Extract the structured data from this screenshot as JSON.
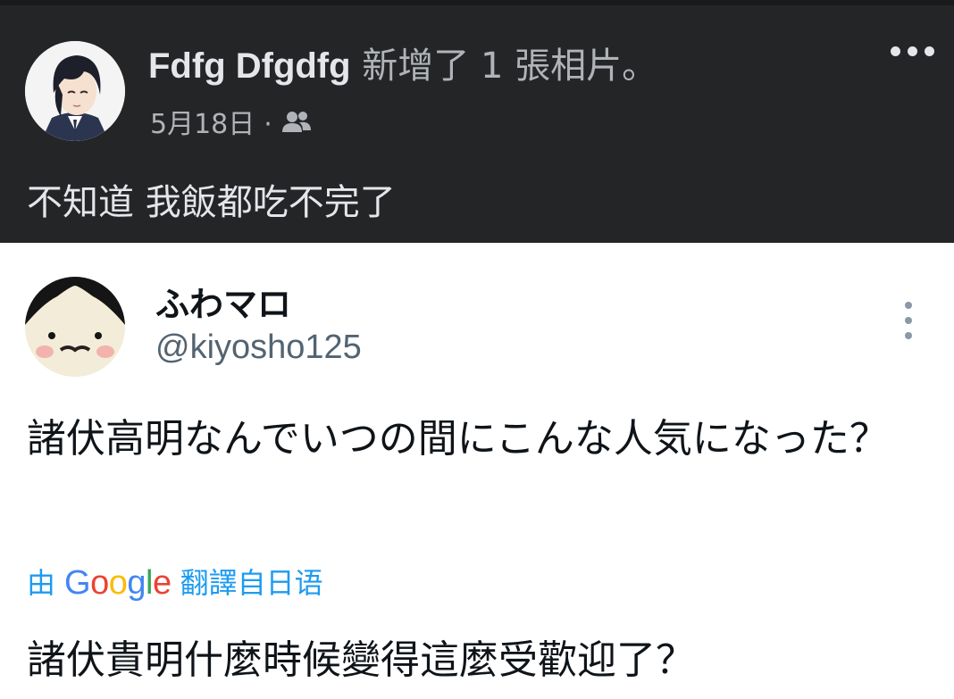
{
  "facebook_post": {
    "author": "Fdfg Dfgdfg",
    "action": "新增了 1 張相片。",
    "date": "5月18日",
    "separator": "·",
    "audience_icon": "friends-icon",
    "more_icon": "more-horizontal-icon",
    "text": "不知道 我飯都吃不完了"
  },
  "tweet": {
    "display_name": "ふわマロ",
    "handle": "@kiyosho125",
    "more_icon": "more-vertical-icon",
    "text": "諸伏高明なんでいつの間にこんな人気になった？",
    "translate_prefix": "由",
    "translate_brand": "Google",
    "translate_suffix": "翻譯自日语",
    "brand_colors": [
      "#4285F4",
      "#EA4335",
      "#FBBC05",
      "#4285F4",
      "#34A853",
      "#EA4335"
    ],
    "translated_text": "諸伏貴明什麼時候變得這麼受歡迎了？"
  }
}
